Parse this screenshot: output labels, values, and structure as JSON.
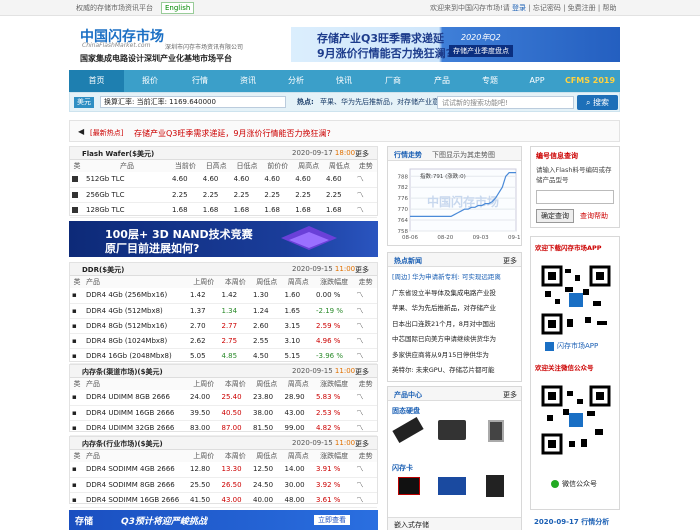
{
  "topbar": {
    "tagline": "权威的存储市场资讯平台",
    "english": "English",
    "welcome": "欢迎来到中国闪存市场!请",
    "login": "登录",
    "forgot": "忘记密码",
    "register": "免费注册",
    "help": "帮助"
  },
  "logo": {
    "cn": "中国闪存市场",
    "en": "ChinaFlashMarket.com",
    "company": "深圳市闪存市场资讯有限公司",
    "slogan": "国家集成电路设计深圳产业化基地市场平台"
  },
  "banner": {
    "line1": "存储产业Q3旺季需求递延",
    "line2": "9月涨价行情能否力挽狂澜?",
    "badge1": "2020年Q2",
    "badge2": "存储产业季度盘点"
  },
  "nav": [
    "首页",
    "报价",
    "行情",
    "资讯",
    "分析",
    "快讯",
    "厂商",
    "产品",
    "专题",
    "APP",
    "CFMS 2019"
  ],
  "search": {
    "label": "美元",
    "rate": "换算汇率: 当前汇率: 1169.640000",
    "hot_label": "热点:",
    "hot": "苹果、华为先后推新品，对存储产业意义重大",
    "placeholder": "试试新的搜索功能吧!",
    "button": "搜索"
  },
  "ticker": {
    "tag": "[最新热点]",
    "text": "存储产业Q3旺季需求递延，9月涨价行情能否力挽狂澜?"
  },
  "wafer": {
    "title": "Flash Wafer($美元)",
    "date": "2020-09-17",
    "time": "18:00",
    "more": "更多",
    "headers": [
      "类",
      "产品",
      "当前价",
      "日高点",
      "日低点",
      "前价价",
      "周高点",
      "周低点",
      "走势"
    ],
    "rows": [
      [
        "512Gb TLC",
        "4.60",
        "4.60",
        "4.60",
        "4.60",
        "4.60",
        "4.60"
      ],
      [
        "256Gb TLC",
        "2.25",
        "2.25",
        "2.25",
        "2.25",
        "2.25",
        "2.25"
      ],
      [
        "128Gb TLC",
        "1.68",
        "1.68",
        "1.68",
        "1.68",
        "1.68",
        "1.68"
      ]
    ]
  },
  "ad1": {
    "line1": "100层+ 3D NAND技术竞赛",
    "line2": "原厂目前进展如何?"
  },
  "ddr": {
    "title": "DDR($美元)",
    "date": "2020-09-15",
    "time": "11:00",
    "more": "更多",
    "headers": [
      "类",
      "产品",
      "上周价",
      "本周价",
      "周低点",
      "周高点",
      "涨跌幅度",
      "走势"
    ],
    "rows": [
      [
        "DDR4 4Gb (256Mbx16)",
        "1.42",
        "1.42",
        "1.30",
        "1.60",
        "0.00 %"
      ],
      [
        "DDR4 4Gb (512Mbx8)",
        "1.37",
        "1.34",
        "1.24",
        "1.65",
        "-2.19 %"
      ],
      [
        "DDR4 8Gb (512Mbx16)",
        "2.70",
        "2.77",
        "2.60",
        "3.15",
        "2.59 %"
      ],
      [
        "DDR4 8Gb (1024Mbx8)",
        "2.62",
        "2.75",
        "2.55",
        "3.10",
        "4.96 %"
      ],
      [
        "DDR4 16Gb (2048Mbx8)",
        "5.05",
        "4.85",
        "4.50",
        "5.15",
        "-3.96 %"
      ]
    ]
  },
  "udimm": {
    "title": "内存条(渠道市场)($美元)",
    "date": "2020-09-15",
    "time": "11:00",
    "more": "更多",
    "headers": [
      "类",
      "产品",
      "上周价",
      "本周价",
      "周低点",
      "周高点",
      "涨跌幅度",
      "走势"
    ],
    "rows": [
      [
        "DDR4 UDIMM 8GB 2666",
        "24.00",
        "25.40",
        "23.80",
        "28.90",
        "5.83 %"
      ],
      [
        "DDR4 UDIMM 16GB 2666",
        "39.50",
        "40.50",
        "38.00",
        "43.00",
        "2.53 %"
      ],
      [
        "DDR4 UDIMM 32GB 2666",
        "83.00",
        "87.00",
        "81.50",
        "99.00",
        "4.82 %"
      ]
    ]
  },
  "sodimm": {
    "title": "内存条(行业市场)($美元)",
    "date": "2020-09-15",
    "time": "11:00",
    "more": "更多",
    "headers": [
      "类",
      "产品",
      "上周价",
      "本周价",
      "周低点",
      "周高点",
      "涨跌幅度",
      "走势"
    ],
    "rows": [
      [
        "DDR4 SODIMM 4GB 2666",
        "12.80",
        "13.30",
        "12.50",
        "14.00",
        "3.91 %"
      ],
      [
        "DDR4 SODIMM 8GB 2666",
        "25.50",
        "26.50",
        "24.50",
        "30.00",
        "3.92 %"
      ],
      [
        "DDR4 SODIMM 16GB 2666",
        "41.50",
        "43.00",
        "40.00",
        "48.00",
        "3.61 %"
      ]
    ]
  },
  "ad2": {
    "t1": "存储",
    "t2": "Q3预计将迎严峻挑战",
    "t3": "立即查看"
  },
  "trend": {
    "tab": "行情走势",
    "caption": "下图显示为其走势图",
    "tooltip": "指数:791 (涨跌:0)",
    "watermark": "中国闪存市场",
    "chart_data": {
      "type": "line",
      "x": [
        "08-06",
        "08-20",
        "09-03",
        "09-17"
      ],
      "y_ticks": [
        788,
        782,
        776,
        770,
        764,
        758
      ],
      "ylim": [
        758,
        792
      ],
      "values": [
        766,
        766,
        766,
        766,
        766,
        766,
        766,
        766,
        766,
        766,
        766,
        766,
        766,
        767,
        768,
        769,
        770,
        770,
        771,
        771,
        772,
        772,
        773,
        773,
        774,
        776,
        779,
        782,
        788,
        790,
        790,
        790
      ],
      "xlim": [
        "08-06",
        "09-17"
      ]
    }
  },
  "news": {
    "title": "热点新闻",
    "more": "更多",
    "items": [
      "[周边] 华为申请新专利: 可实现远距离",
      "广东省设立半导体及集成电路产业投",
      "苹果、华为先后推新品，对存储产业",
      "日本出口连跌21个月，8月对中国出",
      "中芯国际已向美方申请继续供货华为",
      "多家供应商将从9月15日停供华为",
      "英特尔: 未来GPU、存储芯片都可能"
    ]
  },
  "products": {
    "title": "产品中心",
    "more": "更多",
    "cat1": "固态硬盘",
    "cat2": "闪存卡",
    "cat3": "嵌入式存储"
  },
  "right": {
    "code_title": "编号信息查询",
    "code_desc": "请输入Flash料号编码或存储产品型号",
    "query": "确定查询",
    "search_code": "查询帮助",
    "app_title": "欢迎下载闪存市场APP",
    "app_name": "闪存市场APP",
    "wx_title": "欢迎关注微信公众号",
    "wx_name": "微信公众号",
    "bottom": "2020-09-17 行情分析"
  }
}
